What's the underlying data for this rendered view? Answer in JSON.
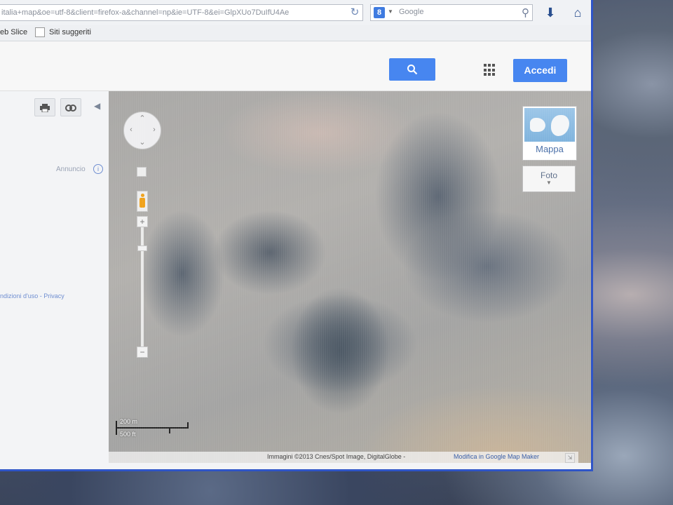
{
  "browser": {
    "url": "italia+map&oe=utf-8&client=firefox-a&channel=np&ie=UTF-8&ei=GlpXUo7DuIfU4Ae",
    "search_engine_placeholder": "Google",
    "search_engine_icon": "8"
  },
  "bookmarks": {
    "web_slice": "eb Slice",
    "suggested_sites": "Siti suggeriti"
  },
  "header": {
    "search_button_icon": "search-icon",
    "signin_label": "Accedi"
  },
  "left_panel": {
    "ad_label": "Annuncio",
    "footer_links": "ndizioni d'uso - Privacy"
  },
  "map": {
    "map_type_label": "Mappa",
    "photos_label": "Foto",
    "scale_metric": "200 m",
    "scale_imperial": "500 ft",
    "attribution": "Immagini ©2013 Cnes/Spot Image, DigitalGlobe -",
    "edit_link": "Modifica in Google Map Maker"
  },
  "colors": {
    "accent_blue": "#4786f0",
    "monitor_frame": "#2f55c8"
  }
}
